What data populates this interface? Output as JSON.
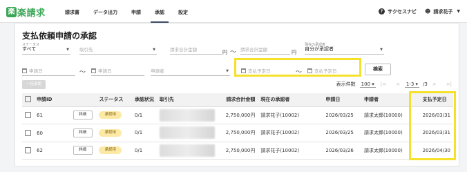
{
  "app": {
    "logo_mark": "楽",
    "logo_text": "楽請求"
  },
  "nav": [
    "請求書",
    "データ出力",
    "申請",
    "承認",
    "設定"
  ],
  "header_right": {
    "help_label": "サクセスナビ",
    "user_name": "請求花子"
  },
  "page_title": "支払依頼申請の承認",
  "filters": {
    "status_label": "ステータス",
    "status_value": "すべて",
    "vendor_placeholder": "取引先",
    "amount_min_placeholder": "請求合計金額",
    "amount_max_placeholder": "請求合計金額",
    "unit": "円",
    "approver_label": "現在の承認者",
    "approver_value": "自分が承認者",
    "apply_date_from_placeholder": "申請日",
    "apply_date_to_placeholder": "申請日",
    "applicant_placeholder": "申請者",
    "pay_date_from_placeholder": "支払予定日",
    "pay_date_to_placeholder": "支払予定日",
    "tilde": "〜"
  },
  "buttons": {
    "search": "検索",
    "bulk_approve": "一括承認"
  },
  "pager": {
    "count_label": "表示件数",
    "count_value": "100",
    "range": "1-3",
    "total": "/3",
    "first": "|<",
    "prev": "<",
    "next": ">",
    "last": ">|"
  },
  "table": {
    "headers": [
      "申請ID",
      "",
      "ステータス",
      "承認状況",
      "取引先",
      "請求合計金額",
      "現在の承認者",
      "申請日",
      "申請者",
      "支払予定日"
    ],
    "detail_label": "詳細",
    "rows": [
      {
        "id": "61",
        "status": "承認待",
        "progress": "0/1",
        "amount": "2,750,000円",
        "approver": "請求花子(10002)",
        "apply_date": "2026/03/25",
        "applicant": "請求太郎(10000)",
        "pay_date": "2026/03/31"
      },
      {
        "id": "60",
        "status": "承認待",
        "progress": "0/1",
        "amount": "2,750,000円",
        "approver": "請求花子(10002)",
        "apply_date": "2026/03/25",
        "applicant": "請求太郎(10000)",
        "pay_date": "2026/03/31"
      },
      {
        "id": "62",
        "status": "承認待",
        "progress": "0/1",
        "amount": "2,750,000円",
        "approver": "請求花子(10002)",
        "apply_date": "2026/03/26",
        "applicant": "請求太郎(10000)",
        "pay_date": "2026/04/30"
      }
    ]
  },
  "colors": {
    "brand": "#3aa655",
    "highlight": "#f5e12a",
    "badge": "#fde9a6"
  }
}
